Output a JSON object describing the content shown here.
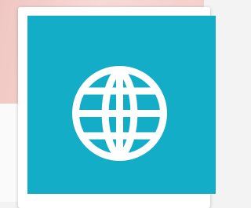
{
  "tile": {
    "icon": "globe-icon",
    "background_color": "#14adc7",
    "icon_color": "#ffffff"
  },
  "background": {
    "top_color": "#f0c6c2",
    "bottom_color": "#fafafa"
  }
}
